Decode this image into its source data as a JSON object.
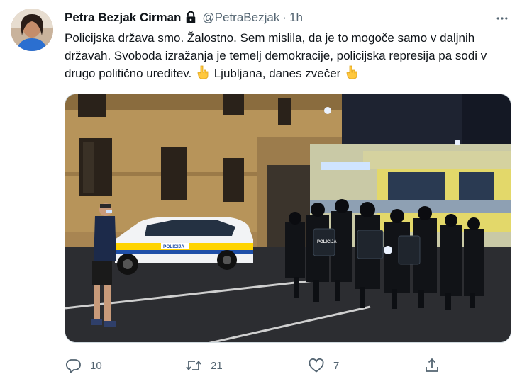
{
  "tweet": {
    "display_name": "Petra Bezjak Cirman",
    "handle": "@PetraBezjak",
    "separator": "·",
    "time": "1h",
    "text_main": "Policijska država smo. Žalostno. Sem mislila, da je to mogoče samo v daljnih državah. Svoboda izražanja je temelj demokracije, policijska represija pa sodi v drugo politično ureditev.",
    "text_location": "Ljubljana, danes zvečer",
    "emoji": "backhand-index-pointing-down",
    "photo_labels": {
      "police_car": "POLICIJA",
      "shield": "POLICIJA"
    }
  },
  "actions": {
    "replies": "10",
    "retweets": "21",
    "likes": "7"
  },
  "icons": [
    "avatar",
    "lock-icon",
    "more-icon",
    "reply-icon",
    "retweet-icon",
    "like-icon",
    "share-icon"
  ],
  "colors": {
    "text": "#0f1419",
    "secondary": "#536471",
    "border": "#cfd9de"
  }
}
